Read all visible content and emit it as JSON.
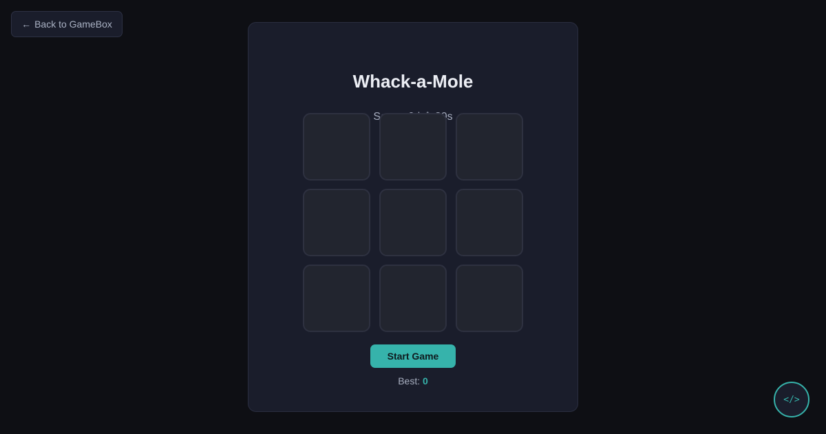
{
  "nav": {
    "back_icon": "arrow-left-icon",
    "back_arrow": "←",
    "back_label": "Back to GameBox"
  },
  "game": {
    "title": "Whack-a-Mole",
    "status": "Score: 0 | ⏱ 30s",
    "score": 0,
    "time_left_seconds": 30,
    "holes": [
      {
        "has_mole": false
      },
      {
        "has_mole": false
      },
      {
        "has_mole": false
      },
      {
        "has_mole": false
      },
      {
        "has_mole": false
      },
      {
        "has_mole": false
      },
      {
        "has_mole": false
      },
      {
        "has_mole": false
      },
      {
        "has_mole": false
      }
    ],
    "start_label": "Start Game",
    "best_label": "Best:",
    "best_value": "0"
  },
  "source_button": {
    "icon": "code-icon",
    "glyph": "</>"
  },
  "colors": {
    "background": "#0e0f14",
    "card": "#1a1d2b",
    "accent": "#36b3ab",
    "hole": "#22252f"
  }
}
